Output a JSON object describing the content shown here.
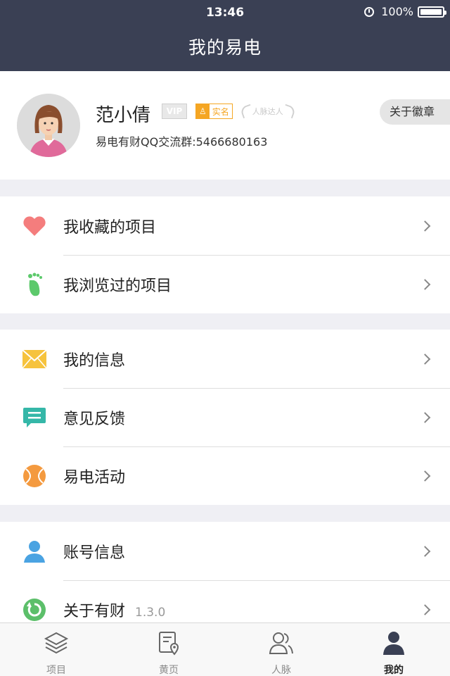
{
  "status_bar": {
    "time": "13:46",
    "battery": "100%"
  },
  "nav": {
    "title": "我的易电"
  },
  "profile": {
    "name": "范小倩",
    "badge_vip": "VIP",
    "badge_realname": "实名",
    "badge_social": "人脉达人",
    "qq_group": "易电有财QQ交流群:5466680163",
    "about_badge": "关于徽章"
  },
  "groups": [
    {
      "items": [
        {
          "label": "我收藏的项目",
          "icon": "heart-icon"
        },
        {
          "label": "我浏览过的项目",
          "icon": "footprint-icon"
        }
      ]
    },
    {
      "items": [
        {
          "label": "我的信息",
          "icon": "envelope-icon"
        },
        {
          "label": "意见反馈",
          "icon": "feedback-icon"
        },
        {
          "label": "易电活动",
          "icon": "ball-icon"
        }
      ]
    },
    {
      "items": [
        {
          "label": "账号信息",
          "icon": "user-icon"
        },
        {
          "label": "关于有财",
          "version": "1.3.0",
          "icon": "refresh-icon"
        }
      ]
    }
  ],
  "tabbar": {
    "tabs": [
      {
        "label": "项目",
        "icon": "layers-icon"
      },
      {
        "label": "黄页",
        "icon": "map-doc-icon"
      },
      {
        "label": "人脉",
        "icon": "people-icon"
      },
      {
        "label": "我的",
        "icon": "person-icon",
        "active": true
      }
    ]
  },
  "colors": {
    "header": "#3a4054",
    "heart": "#f47d7d",
    "foot": "#5cc96b",
    "envelope": "#f6c33d",
    "feedback": "#35b7a8",
    "ball": "#f49a3f",
    "user": "#4aa3e2",
    "refresh": "#5cbf6a"
  }
}
